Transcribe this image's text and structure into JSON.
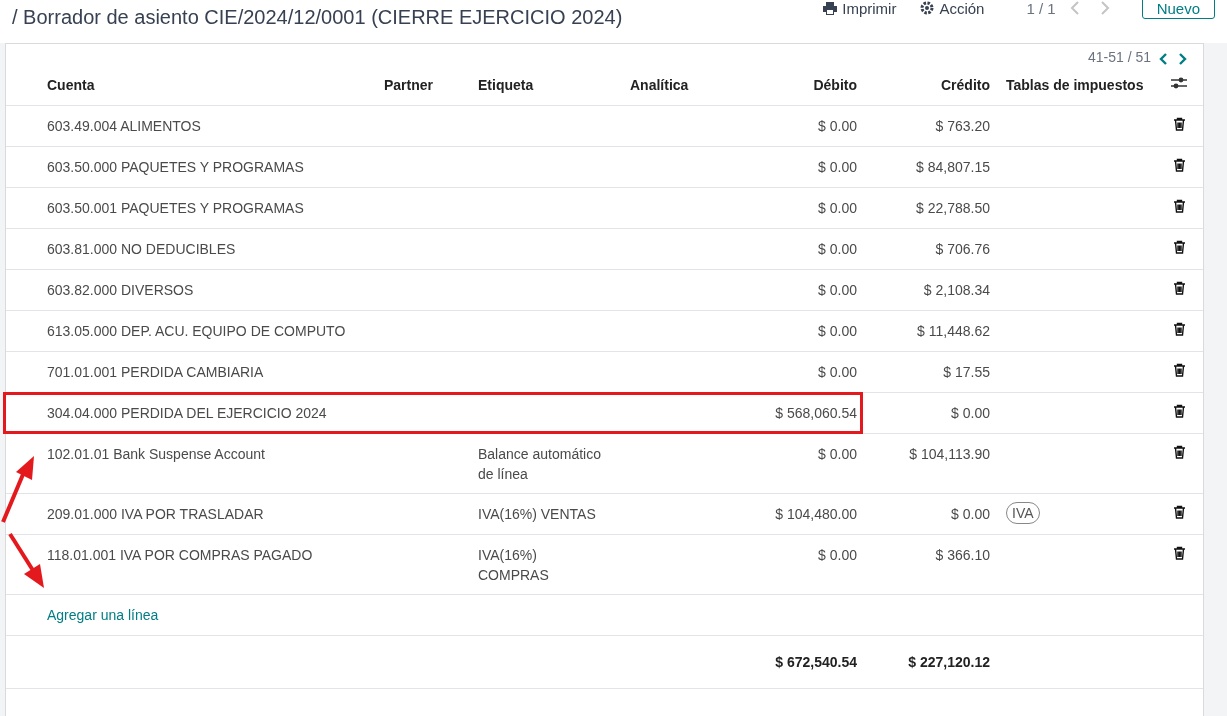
{
  "breadcrumb": "/ Borrador de asiento CIE/2024/12/0001 (CIERRE EJERCICIO 2024)",
  "toolbar": {
    "print": "Imprimir",
    "action": "Acción",
    "pager": "1 / 1",
    "new_button": "Nuevo"
  },
  "table": {
    "pager": "41-51 / 51",
    "columns": [
      "Cuenta",
      "Partner",
      "Etiqueta",
      "Analítica",
      "Débito",
      "Crédito",
      "Tablas de impuestos"
    ],
    "rows": [
      {
        "account": "603.49.004 ALIMENTOS",
        "debit": "$ 0.00",
        "credit": "$ 763.20",
        "highlighted": false
      },
      {
        "account": "603.50.000 PAQUETES Y PROGRAMAS",
        "debit": "$ 0.00",
        "credit": "$ 84,807.15",
        "highlighted": false
      },
      {
        "account": "603.50.001 PAQUETES Y PROGRAMAS",
        "debit": "$ 0.00",
        "credit": "$ 22,788.50",
        "highlighted": false
      },
      {
        "account": "603.81.000 NO DEDUCIBLES",
        "debit": "$ 0.00",
        "credit": "$ 706.76",
        "highlighted": false
      },
      {
        "account": "603.82.000 DIVERSOS",
        "debit": "$ 0.00",
        "credit": "$ 2,108.34",
        "highlighted": false
      },
      {
        "account": "613.05.000 DEP. ACU. EQUIPO DE COMPUTO",
        "debit": "$ 0.00",
        "credit": "$ 11,448.62",
        "highlighted": false
      },
      {
        "account": "701.01.001 PERDIDA CAMBIARIA",
        "debit": "$ 0.00",
        "credit": "$ 17.55",
        "highlighted": false
      },
      {
        "account": "304.04.000 PERDIDA DEL EJERCICIO 2024",
        "debit": "$ 568,060.54",
        "credit": "$ 0.00",
        "highlighted": true
      },
      {
        "account": "102.01.01 Bank Suspense Account",
        "label": "Balance automático de línea",
        "debit": "$ 0.00",
        "credit": "$ 104,113.90",
        "highlighted": false
      },
      {
        "account": "209.01.000 IVA POR TRASLADAR",
        "label": "IVA(16%) VENTAS",
        "debit": "$ 104,480.00",
        "credit": "$ 0.00",
        "taxes": [
          "IVA"
        ],
        "highlighted": false
      },
      {
        "account": "118.01.001 IVA POR COMPRAS PAGADO",
        "label": "IVA(16%) COMPRAS",
        "debit": "$ 0.00",
        "credit": "$ 366.10",
        "highlighted": false
      }
    ],
    "add_line": "Agregar una línea",
    "totals": {
      "debit": "$ 672,540.54",
      "credit": "$ 227,120.12"
    }
  },
  "annotation_arrows": true
}
